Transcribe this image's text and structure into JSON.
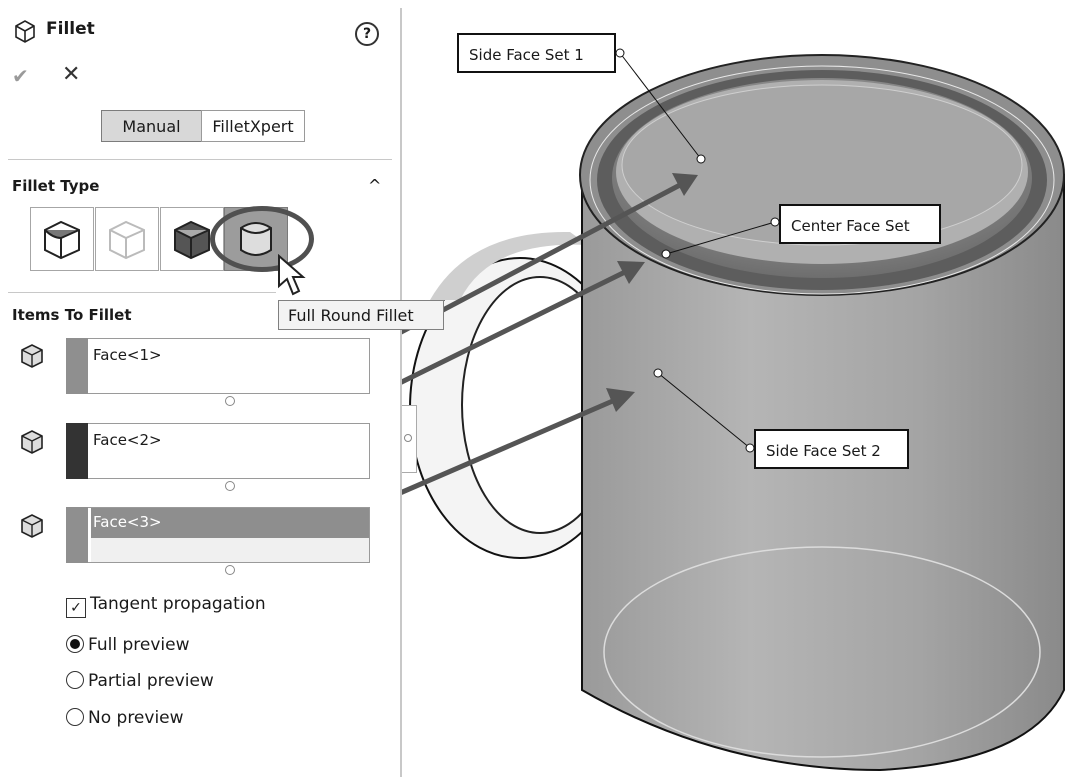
{
  "panel": {
    "title": "Fillet",
    "help_icon": "?",
    "ok_icon": "checkmark-icon",
    "cancel_icon": "close-icon",
    "modes": [
      "Manual",
      "FilletXpert"
    ],
    "fillet_type": {
      "heading": "Fillet Type",
      "buttons": [
        "constant-size-fillet-icon",
        "variable-size-fillet-icon",
        "face-fillet-icon",
        "full-round-fillet-icon"
      ],
      "selected": "full-round-fillet-icon"
    },
    "tooltip": "Full Round Fillet",
    "items_heading": "Items To Fillet",
    "faces": [
      {
        "label": "Face<1>",
        "swatch": "#8f8f8f"
      },
      {
        "label": "Face<2>",
        "swatch": "#333333"
      },
      {
        "label": "Face<3>",
        "swatch": "#8f8f8f"
      }
    ],
    "tangent_propagation": {
      "label": "Tangent propagation",
      "checked": true
    },
    "preview_options": {
      "full": "Full preview",
      "partial": "Partial preview",
      "none": "No preview",
      "selected": "full"
    }
  },
  "callouts": {
    "side1": "Side Face Set 1",
    "center": "Center Face Set",
    "side2": "Side Face Set 2"
  }
}
